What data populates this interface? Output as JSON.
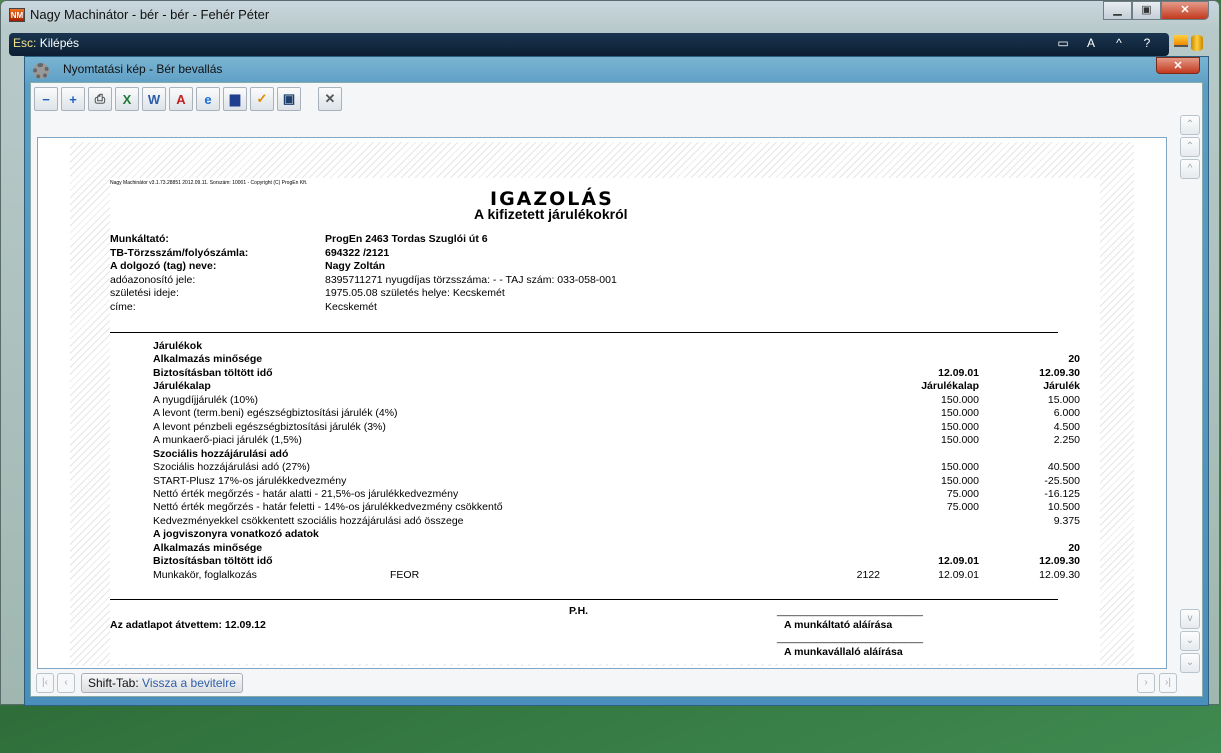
{
  "window": {
    "title": "Nagy Machinátor - bér - bér - Fehér Péter",
    "app_icon": "NM"
  },
  "escbar": {
    "key": "Esc:",
    "label": "Kilépés",
    "icons": [
      "▭",
      "A",
      "^",
      "?"
    ]
  },
  "child": {
    "title": "Nyomtatási kép - Bér bevallás"
  },
  "toolbar": [
    {
      "name": "zoom-out",
      "glyph": "−",
      "color": "#1f5fbf"
    },
    {
      "name": "zoom-in",
      "glyph": "+",
      "color": "#1f5fbf"
    },
    {
      "name": "print",
      "glyph": "⎙",
      "color": "#555"
    },
    {
      "name": "excel",
      "glyph": "X",
      "color": "#1e7b34"
    },
    {
      "name": "word",
      "glyph": "W",
      "color": "#2a5caa"
    },
    {
      "name": "pdf",
      "glyph": "A",
      "color": "#c81e1e"
    },
    {
      "name": "internet-explorer",
      "glyph": "e",
      "color": "#1e6fd0"
    },
    {
      "name": "monitor",
      "glyph": "▆",
      "color": "#1f3f8f"
    },
    {
      "name": "outlook",
      "glyph": "✓",
      "color": "#e08a00"
    },
    {
      "name": "archive",
      "glyph": "▣",
      "color": "#1f3f6f"
    },
    {
      "name": "tools",
      "glyph": "✕",
      "color": "#555"
    }
  ],
  "doc": {
    "header_line": "Nagy Machinátor v3.1.73.28851 2012.09.11. Sorszám: 10001 - Copyright (C) ProgEn Kft.",
    "title": "IGAZOLÁS",
    "subtitle": "A kifizetett járulékokról",
    "fields": [
      {
        "label": "Munkáltató:",
        "value": "ProgEn 2463 Tordas Szuglói út 6",
        "bold": true
      },
      {
        "label": "TB-Törzsszám/folyószámla:",
        "value": "694322  /2121",
        "bold": true
      },
      {
        "label": "A dolgozó (tag) neve:",
        "value": "Nagy Zoltán",
        "bold": true
      },
      {
        "label": "adóazonosító jele:",
        "value": "8395711271  nyugdíjas törzsszáma:    -     -  TAJ szám:  033-058-001",
        "bold": false
      },
      {
        "label": "születési ideje:",
        "value": "1975.05.08 születés helye:  Kecskemét",
        "bold": false
      },
      {
        "label": "címe:",
        "value": "Kecskemét",
        "bold": false
      }
    ],
    "rows": [
      {
        "label": "Járulékok",
        "bold": true
      },
      {
        "label": "Alkalmazás minősége",
        "bold": true,
        "c3": "20"
      },
      {
        "label": "Biztosításban töltött idő",
        "bold": true,
        "c2": "12.09.01",
        "c3": "12.09.30"
      },
      {
        "label": "Járulékalap",
        "bold": true,
        "c2": "Járulékalap",
        "c3": "Járulék",
        "hdr": true
      },
      {
        "label": "A nyugdíjjárulék (10%)",
        "c2": "150.000",
        "c3": "15.000"
      },
      {
        "label": "A levont (term.beni) egészségbiztosítási járulék (4%)",
        "c2": "150.000",
        "c3": "6.000"
      },
      {
        "label": "A levont pénzbeli egészségbiztosítási járulék (3%)",
        "c2": "150.000",
        "c3": "4.500"
      },
      {
        "label": "A munkaerő-piaci járulék (1,5%)",
        "c2": "150.000",
        "c3": "2.250"
      },
      {
        "label": "Szociális hozzájárulási adó",
        "bold": true
      },
      {
        "label": "Szociális hozzájárulási adó (27%)",
        "c2": "150.000",
        "c3": "40.500"
      },
      {
        "label": "START-Plusz 17%-os járulékkedvezmény",
        "c2": "150.000",
        "c3": "-25.500"
      },
      {
        "label": "Nettó érték megőrzés - határ alatti - 21,5%-os járulékkedvezmény",
        "c2": "75.000",
        "c3": "-16.125"
      },
      {
        "label": "Nettó érték megőrzés - határ feletti - 14%-os járulékkedvezmény csökkentő",
        "c2": "75.000",
        "c3": "10.500"
      },
      {
        "label": "Kedvezményekkel csökkentett szociális hozzájárulási adó összege",
        "c3": "9.375"
      },
      {
        "label": "A jogviszonyra vonatkozó adatok",
        "bold": true
      },
      {
        "label": "Alkalmazás minősége",
        "bold": true,
        "c3": "20"
      },
      {
        "label": "Biztosításban töltött idő",
        "bold": true,
        "c2": "12.09.01",
        "c3": "12.09.30"
      },
      {
        "label": "Munkakör, foglalkozás",
        "mid": "FEOR",
        "c1": "2122",
        "c2": "12.09.01",
        "c3": "12.09.30"
      }
    ],
    "ph": "P.H.",
    "received": "Az adatlapot átvettem: 12.09.12",
    "sig_line": "_________________________",
    "employer_sig": "A munkáltató aláírása",
    "employee_sig": "A munkavállaló aláírása"
  },
  "footer": {
    "key": "Shift-Tab:",
    "label": "Vissza a bevitelre"
  }
}
